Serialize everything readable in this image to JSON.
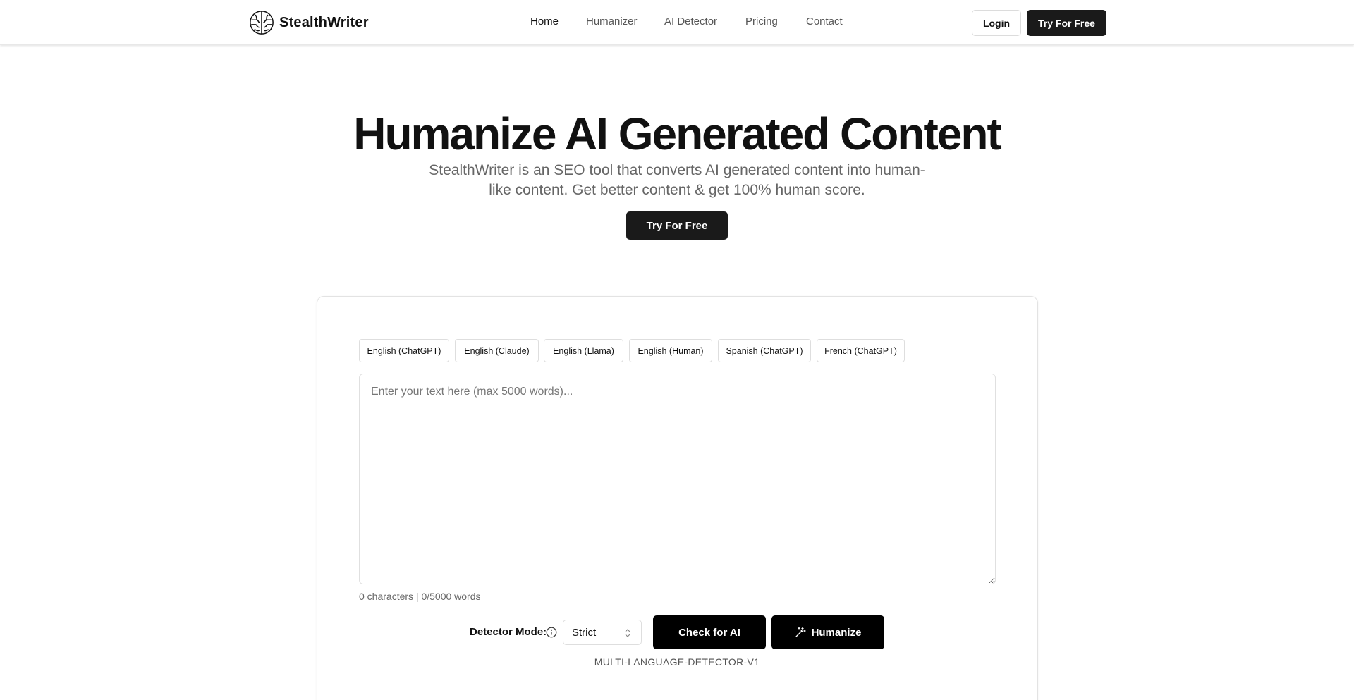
{
  "header": {
    "brand_name": "StealthWriter",
    "nav": [
      {
        "label": "Home",
        "active": true
      },
      {
        "label": "Humanizer",
        "active": false
      },
      {
        "label": "AI Detector",
        "active": false
      },
      {
        "label": "Pricing",
        "active": false
      },
      {
        "label": "Contact",
        "active": false
      }
    ],
    "login_label": "Login",
    "try_label": "Try For Free"
  },
  "hero": {
    "title": "Humanize AI Generated Content",
    "subtitle_line1": "StealthWriter is an SEO tool that converts AI generated content into human-",
    "subtitle_line2": "like content. Get better content & get 100% human score.",
    "cta_label": "Try For Free"
  },
  "tool": {
    "samples": [
      "English (ChatGPT)",
      "English (Claude)",
      "English (Llama)",
      "English (Human)",
      "Spanish (ChatGPT)",
      "French (ChatGPT)"
    ],
    "input_placeholder": "Enter your text here (max 5000 words)...",
    "input_value": "",
    "counter": "0 characters | 0/5000 words",
    "detector_mode_label": "Detector Mode:",
    "detector_mode_value": "Strict",
    "check_label": "Check for AI",
    "humanize_label": "Humanize",
    "model_tag": "MULTI-LANGUAGE-DETECTOR-V1"
  },
  "icons": {
    "logo": "brain-logo-icon",
    "info": "info-icon",
    "select_chevron": "chevron-up-down-icon",
    "humanize": "magic-wand-icon"
  },
  "colors": {
    "primary_button": "#1a1a1a",
    "text": "#111111",
    "muted_text": "#666666",
    "border": "#e0e0e0"
  }
}
